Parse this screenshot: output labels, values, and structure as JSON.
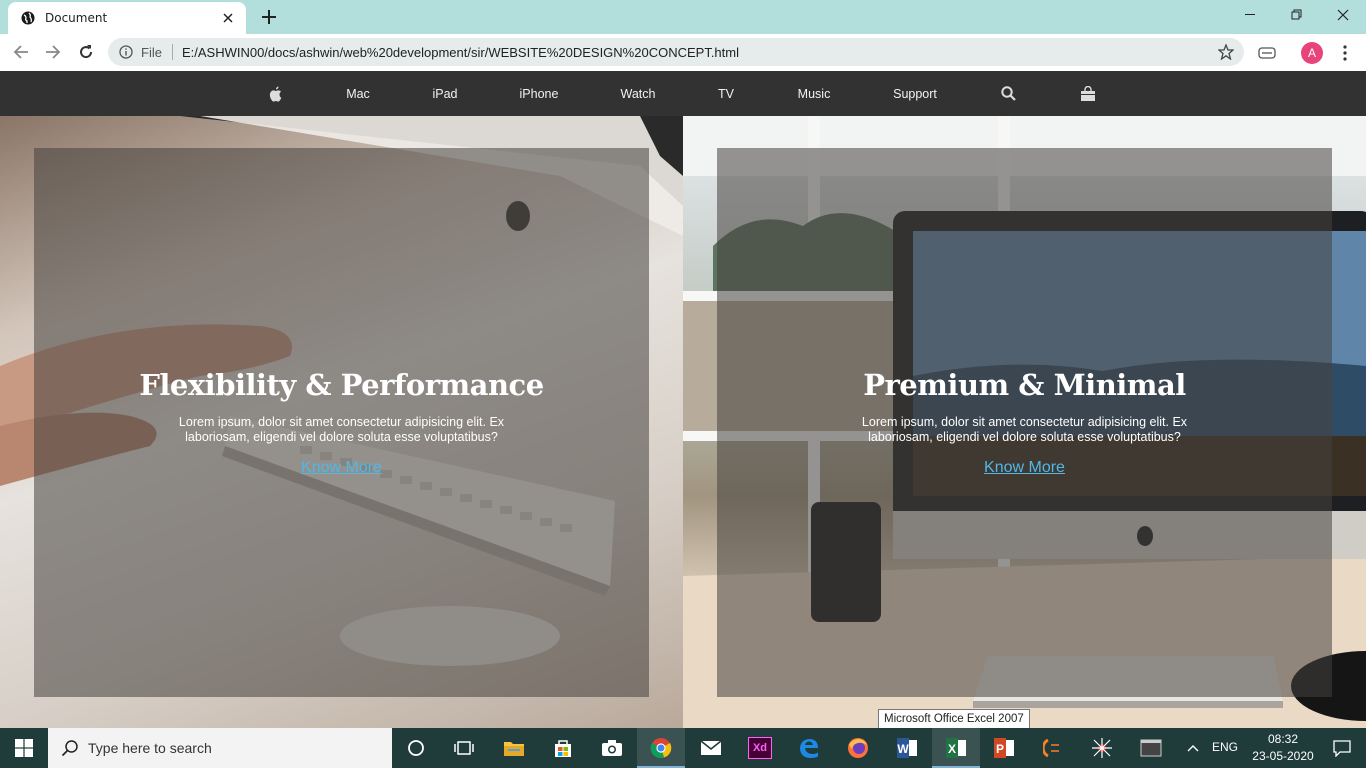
{
  "browser": {
    "tab_title": "Document",
    "address_scheme_chip": "File",
    "url": "E:/ASHWIN00/docs/ashwin/web%20development/sir/WEBSITE%20DESIGN%20CONCEPT.html",
    "profile_initial": "A",
    "profile_color": "#e8437a"
  },
  "site_nav": {
    "items": [
      "Mac",
      "iPad",
      "iPhone",
      "Watch",
      "TV",
      "Music",
      "Support"
    ],
    "icons": [
      "apple-logo-icon",
      "search-icon",
      "shopping-bag-icon"
    ]
  },
  "hero": {
    "left": {
      "title": "Flexibility & Performance",
      "body": "Lorem ipsum, dolor sit amet consectetur adipisicing elit. Ex laboriosam, eligendi vel dolore soluta esse voluptatibus?",
      "link": "Know More"
    },
    "right": {
      "title": "Premium & Minimal",
      "body": "Lorem ipsum, dolor sit amet consectetur adipisicing elit. Ex laboriosam, eligendi vel dolore soluta esse voluptatibus?",
      "link": "Know More"
    },
    "link_color": "#4fb8e8"
  },
  "tooltip": "Microsoft Office Excel 2007",
  "taskbar": {
    "search_placeholder": "Type here to search",
    "apps": [
      "cortana-icon",
      "task-view-icon",
      "file-explorer-icon",
      "store-icon",
      "camera-icon",
      "chrome-icon",
      "mail-icon",
      "adobe-xd-icon",
      "edge-icon",
      "firefox-icon",
      "word-icon",
      "excel-icon",
      "powerpoint-icon",
      "eclipse-icon",
      "spider-icon",
      "terminal-icon"
    ],
    "xd_label": "Xd",
    "language": "ENG",
    "time": "08:32",
    "date": "23-05-2020"
  }
}
